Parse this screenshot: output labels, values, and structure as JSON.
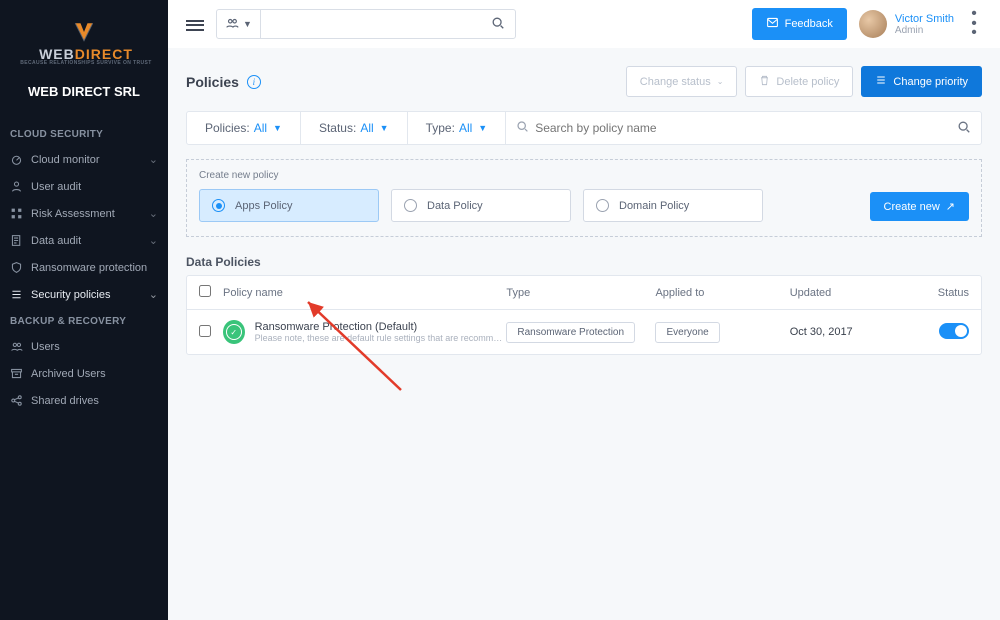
{
  "brand": {
    "word1": "WEB",
    "word2": "DIRECT",
    "tagline": "BECAUSE RELATIONSHIPS SURVIVE ON TRUST",
    "org": "WEB DIRECT SRL"
  },
  "sidebar": {
    "sections": [
      {
        "title": "CLOUD SECURITY",
        "items": [
          {
            "label": "Cloud monitor",
            "expandable": true
          },
          {
            "label": "User audit",
            "expandable": false
          },
          {
            "label": "Risk Assessment",
            "expandable": true
          },
          {
            "label": "Data audit",
            "expandable": true
          },
          {
            "label": "Ransomware protection",
            "expandable": false
          },
          {
            "label": "Security policies",
            "expandable": true,
            "active": true
          }
        ]
      },
      {
        "title": "BACKUP & RECOVERY",
        "items": [
          {
            "label": "Users",
            "expandable": false
          },
          {
            "label": "Archived Users",
            "expandable": false
          },
          {
            "label": "Shared drives",
            "expandable": false
          }
        ]
      }
    ]
  },
  "topbar": {
    "feedback": "Feedback",
    "user_name": "Victor Smith",
    "user_role": "Admin",
    "search_placeholder": ""
  },
  "page": {
    "title": "Policies",
    "actions": {
      "change_status": "Change status",
      "delete": "Delete policy",
      "change_priority": "Change priority"
    },
    "filters": {
      "policies_label": "Policies:",
      "policies_value": "All",
      "status_label": "Status:",
      "status_value": "All",
      "type_label": "Type:",
      "type_value": "All",
      "search_placeholder": "Search by policy name"
    },
    "create": {
      "title": "Create new policy",
      "options": [
        {
          "label": "Apps Policy",
          "selected": true
        },
        {
          "label": "Data Policy",
          "selected": false
        },
        {
          "label": "Domain Policy",
          "selected": false
        }
      ],
      "button": "Create new"
    },
    "table": {
      "section_title": "Data Policies",
      "columns": {
        "name": "Policy name",
        "type": "Type",
        "applied": "Applied to",
        "updated": "Updated",
        "status": "Status"
      },
      "rows": [
        {
          "name": "Ransomware Protection (Default)",
          "subtitle": "Please note, these are default rule settings that are recommended by Spinbac...",
          "type": "Ransomware Protection",
          "applied": "Everyone",
          "updated": "Oct 30, 2017",
          "status": "on"
        }
      ]
    }
  }
}
